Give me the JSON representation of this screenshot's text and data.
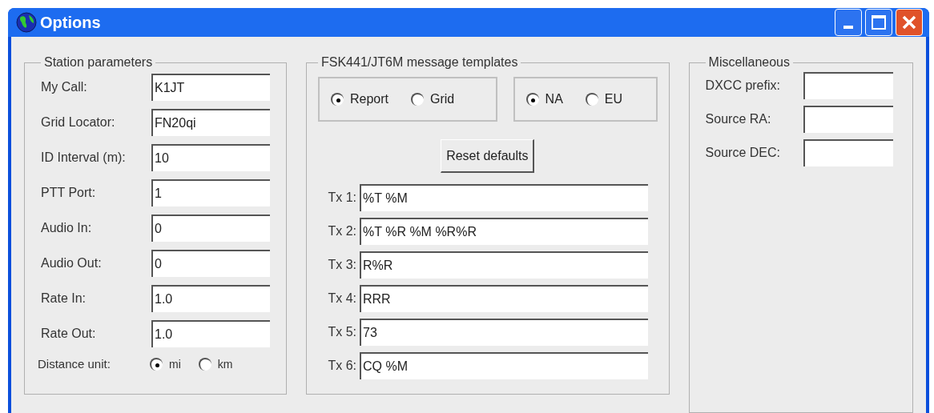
{
  "window": {
    "title": "Options"
  },
  "station": {
    "title": "Station parameters",
    "fields": [
      {
        "label": "My Call:",
        "value": "K1JT"
      },
      {
        "label": "Grid Locator:",
        "value": "FN20qi"
      },
      {
        "label": "ID Interval (m):",
        "value": "10"
      },
      {
        "label": "PTT Port:",
        "value": "1"
      },
      {
        "label": "Audio In:",
        "value": "0"
      },
      {
        "label": "Audio Out:",
        "value": "0"
      },
      {
        "label": "Rate In:",
        "value": "1.0"
      },
      {
        "label": "Rate Out:",
        "value": "1.0"
      }
    ],
    "distance_unit": {
      "label": "Distance unit:",
      "options": [
        {
          "label": "mi",
          "selected": true
        },
        {
          "label": "km",
          "selected": false
        }
      ]
    }
  },
  "templates": {
    "title": "FSK441/JT6M message templates",
    "radio_groups": [
      [
        {
          "label": "Report",
          "selected": true
        },
        {
          "label": "Grid",
          "selected": false
        }
      ],
      [
        {
          "label": "NA",
          "selected": true
        },
        {
          "label": "EU",
          "selected": false
        }
      ]
    ],
    "reset_button": "Reset defaults",
    "fields": [
      {
        "label": "Tx 1:",
        "value": "%T %M"
      },
      {
        "label": "Tx 2:",
        "value": "%T %R %M %R%R"
      },
      {
        "label": "Tx 3:",
        "value": "R%R"
      },
      {
        "label": "Tx 4:",
        "value": "RRR"
      },
      {
        "label": "Tx 5:",
        "value": "73"
      },
      {
        "label": "Tx 6:",
        "value": "CQ %M"
      }
    ]
  },
  "misc": {
    "title": "Miscellaneous",
    "fields": [
      {
        "label": "DXCC prefix:"
      },
      {
        "label": "Source RA:"
      },
      {
        "label": "Source DEC:"
      }
    ]
  }
}
